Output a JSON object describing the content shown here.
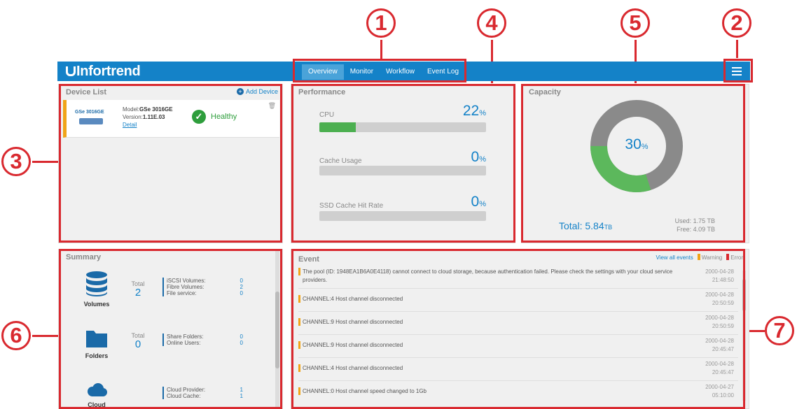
{
  "callouts": [
    "1",
    "2",
    "3",
    "4",
    "5",
    "6",
    "7"
  ],
  "topbar": {
    "brand": "Infortrend",
    "tabs": [
      "Overview",
      "Monitor",
      "Workflow",
      "Event Log"
    ],
    "active_tab": "Overview",
    "menu_icon": "hamburger-icon"
  },
  "device_list": {
    "title": "Device List",
    "add_label": "Add Device",
    "device": {
      "name": "GSe 3016GE",
      "model_label": "Model:",
      "model": "GSe 3016GE",
      "version_label": "Version:",
      "version": "1.11E.03",
      "detail_link": "Detail",
      "status": "Healthy"
    }
  },
  "performance": {
    "title": "Performance",
    "metrics": [
      {
        "label": "CPU",
        "value": "22",
        "unit": "%",
        "fraction": 0.22
      },
      {
        "label": "Cache Usage",
        "value": "0",
        "unit": "%",
        "fraction": 0
      },
      {
        "label": "SSD Cache Hit Rate",
        "value": "0",
        "unit": "%",
        "fraction": 0
      }
    ]
  },
  "capacity": {
    "title": "Capacity",
    "percent": "30",
    "percent_unit": "%",
    "used_fraction": 0.3,
    "total_label": "Total:",
    "total_value": "5.84",
    "total_unit": "TB",
    "used": "Used: 1.75 TB",
    "free": "Free: 4.09 TB",
    "colors": {
      "used": "#5cb85c",
      "free": "#8a8a8a"
    }
  },
  "summary": {
    "title": "Summary",
    "groups": [
      {
        "label": "Volumes",
        "icon": "database-icon",
        "total_label": "Total",
        "total": "2",
        "items": [
          {
            "label": "iSCSI Volumes:",
            "value": "0"
          },
          {
            "label": "Fibre Volumes:",
            "value": "2"
          },
          {
            "label": "File service:",
            "value": "0"
          }
        ]
      },
      {
        "label": "Folders",
        "icon": "folder-icon",
        "total_label": "Total",
        "total": "0",
        "items": [
          {
            "label": "Share Folders:",
            "value": "0"
          },
          {
            "label": "Online Users:",
            "value": "0"
          }
        ]
      },
      {
        "label": "Cloud",
        "icon": "cloud-icon",
        "items": [
          {
            "label": "Cloud Provider:",
            "value": "1"
          },
          {
            "label": "Cloud Cache:",
            "value": "1"
          }
        ]
      }
    ]
  },
  "events": {
    "title": "Event",
    "view_all": "View all events",
    "legend": [
      {
        "label": "Warning",
        "color": "#f0a418"
      },
      {
        "label": "Error",
        "color": "#d9292f"
      }
    ],
    "rows": [
      {
        "msg": "The pool (ID: 1948EA1B6A0E4118) cannot connect to cloud storage, because authentication failed. Please check the settings with your cloud service providers.",
        "date": "2000-04-28",
        "time": "21:48:50"
      },
      {
        "msg": "CHANNEL:4 Host channel disconnected",
        "date": "2000-04-28",
        "time": "20:50:59"
      },
      {
        "msg": "CHANNEL:9 Host channel disconnected",
        "date": "2000-04-28",
        "time": "20:50:59"
      },
      {
        "msg": "CHANNEL:9 Host channel disconnected",
        "date": "2000-04-28",
        "time": "20:45:47"
      },
      {
        "msg": "CHANNEL:4 Host channel disconnected",
        "date": "2000-04-28",
        "time": "20:45:47"
      },
      {
        "msg": "CHANNEL:0 Host channel speed changed to 1Gb",
        "date": "2000-04-27",
        "time": "05:10:00"
      }
    ]
  }
}
